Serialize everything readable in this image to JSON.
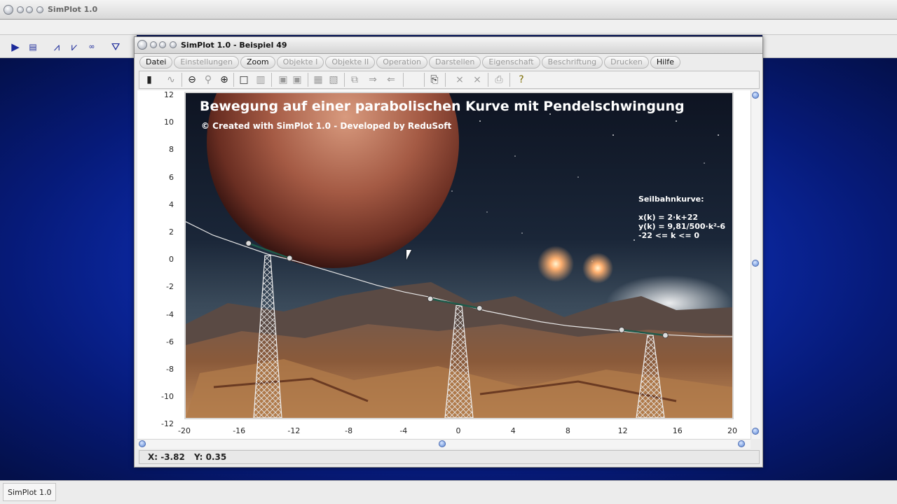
{
  "app": {
    "outer_title": "SimPlot 1.0",
    "taskbar_item": "SimPlot 1.0"
  },
  "window": {
    "title": "SimPlot 1.0 - Beispiel 49"
  },
  "menu": [
    {
      "label": "Datei",
      "enabled": true
    },
    {
      "label": "Einstellungen",
      "enabled": false
    },
    {
      "label": "Zoom",
      "enabled": true
    },
    {
      "label": "Objekte I",
      "enabled": false
    },
    {
      "label": "Objekte II",
      "enabled": false
    },
    {
      "label": "Operation",
      "enabled": false
    },
    {
      "label": "Darstellen",
      "enabled": false
    },
    {
      "label": "Eigenschaft",
      "enabled": false
    },
    {
      "label": "Beschriftung",
      "enabled": false
    },
    {
      "label": "Drucken",
      "enabled": false
    },
    {
      "label": "Hilfe",
      "enabled": true
    }
  ],
  "plot": {
    "title": "Bewegung auf einer parabolischen Kurve mit Pendelschwingung",
    "credit": "© Created with SimPlot 1.0 - Developed by ReduSoft",
    "formula_heading": "Seilbahnkurve:",
    "formula_lines": [
      "x(k) = 2·k+22",
      "y(k) = 9,81/500·k²-6",
      "-22 <= k <= 0"
    ],
    "y_ticks": [
      "12",
      "10",
      "8",
      "6",
      "4",
      "2",
      "0",
      "-2",
      "-4",
      "-6",
      "-8",
      "-10",
      "-12"
    ],
    "x_ticks": [
      "-20",
      "-16",
      "-12",
      "-8",
      "-4",
      "0",
      "4",
      "8",
      "12",
      "16",
      "20"
    ]
  },
  "chart_data": {
    "type": "line",
    "title": "Bewegung auf einer parabolischen Kurve mit Pendelschwingung",
    "xlim": [
      -20,
      20
    ],
    "ylim": [
      -12,
      12
    ],
    "series": [
      {
        "name": "Seilbahnkurve",
        "x": [
          -20,
          -18,
          -16,
          -14,
          -12,
          -10,
          -8,
          -6,
          -4,
          -2,
          0,
          2,
          4,
          6,
          8,
          10,
          12,
          14,
          16,
          18,
          20
        ],
        "y": [
          2.5,
          1.5,
          0.8,
          0.1,
          -0.4,
          -1.0,
          -1.6,
          -2.2,
          -2.7,
          -3.1,
          -3.6,
          -4.1,
          -4.5,
          -4.9,
          -5.2,
          -5.4,
          -5.6,
          -5.8,
          -5.9,
          -6.0,
          -6.0
        ]
      }
    ],
    "pylons_x": [
      -14,
      0,
      14
    ],
    "gondola_points": [
      {
        "x": -15.4,
        "y": 0.9
      },
      {
        "x": -12.4,
        "y": -0.2
      },
      {
        "x": -2.1,
        "y": -3.2
      },
      {
        "x": 1.5,
        "y": -3.9
      },
      {
        "x": 11.9,
        "y": -5.5
      },
      {
        "x": 15.1,
        "y": -5.9
      }
    ]
  },
  "status": {
    "x": "X: -3.82",
    "y": "Y: 0.35"
  },
  "colors": {
    "accent": "#1c2a9a",
    "desktop": "#0c2aa8",
    "cable": "#e8e8e8",
    "gondola": "#1e5a4a"
  }
}
